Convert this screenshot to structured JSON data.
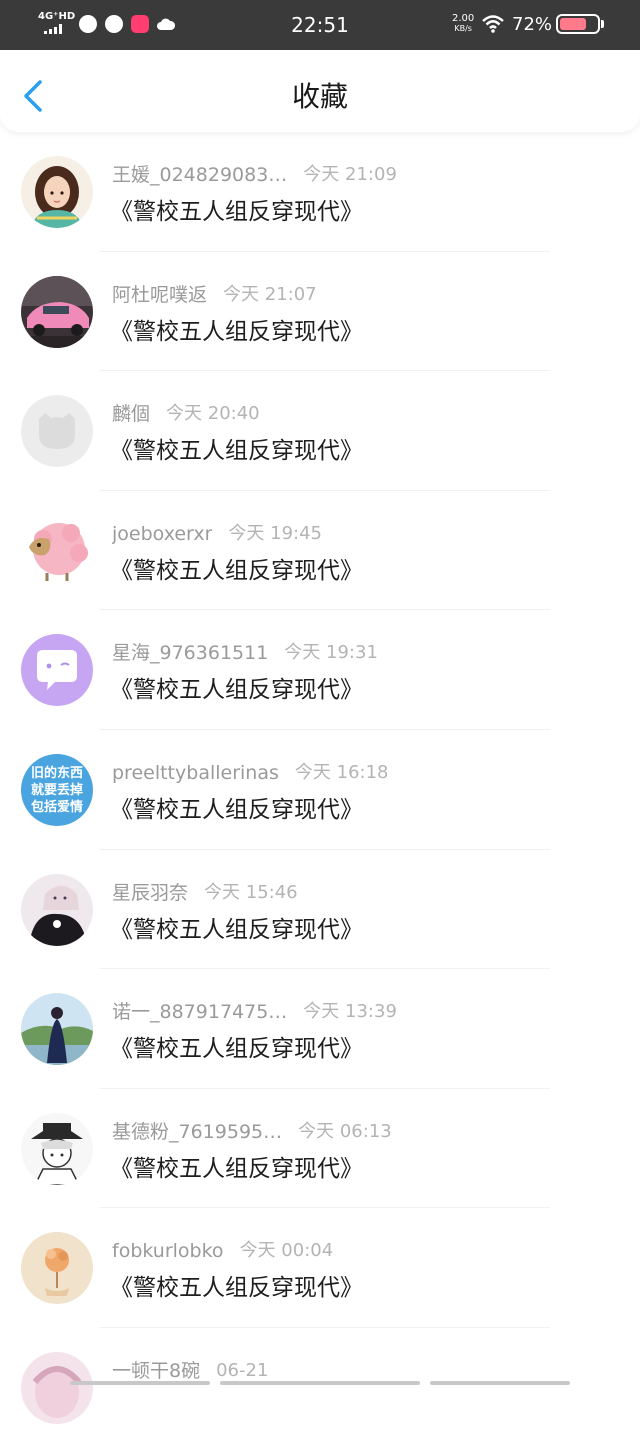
{
  "status_bar": {
    "network": "4G⁺HD",
    "time": "22:51",
    "speed_value": "2.00",
    "speed_unit": "KB/s",
    "battery": "72%",
    "battery_level": 0.72
  },
  "header": {
    "title": "收藏",
    "back_icon": "chevron-left-icon"
  },
  "favorites": [
    {
      "name": "王媛_024829083…",
      "time": "今天 21:09",
      "book": "《警校五人组反穿现代》"
    },
    {
      "name": "阿杜呢噗返",
      "time": "今天 21:07",
      "book": "《警校五人组反穿现代》"
    },
    {
      "name": "麟個",
      "time": "今天 20:40",
      "book": "《警校五人组反穿现代》"
    },
    {
      "name": "joeboxerxr",
      "time": "今天 19:45",
      "book": "《警校五人组反穿现代》"
    },
    {
      "name": "星海_976361511",
      "time": "今天 19:31",
      "book": "《警校五人组反穿现代》"
    },
    {
      "name": "preelttyballerinas",
      "time": "今天 16:18",
      "book": "《警校五人组反穿现代》"
    },
    {
      "name": "星辰羽奈",
      "time": "今天 15:46",
      "book": "《警校五人组反穿现代》"
    },
    {
      "name": "诺一_887917475…",
      "time": "今天 13:39",
      "book": "《警校五人组反穿现代》"
    },
    {
      "name": "基德粉_7619595…",
      "time": "今天 06:13",
      "book": "《警校五人组反穿现代》"
    },
    {
      "name": "fobkurlobko",
      "time": "今天 00:04",
      "book": "《警校五人组反穿现代》"
    },
    {
      "name": "一顿干8碗",
      "time": "06-21",
      "book": ""
    }
  ],
  "avatar_texts": {
    "item6": [
      "旧的东西",
      "就要丢掉",
      "包括爱情"
    ]
  },
  "colors": {
    "accent": "#2a9df4",
    "status_bar_bg": "#3a3a3a",
    "meta_text": "#9a9a9a",
    "book_text": "#1e1e1e"
  }
}
